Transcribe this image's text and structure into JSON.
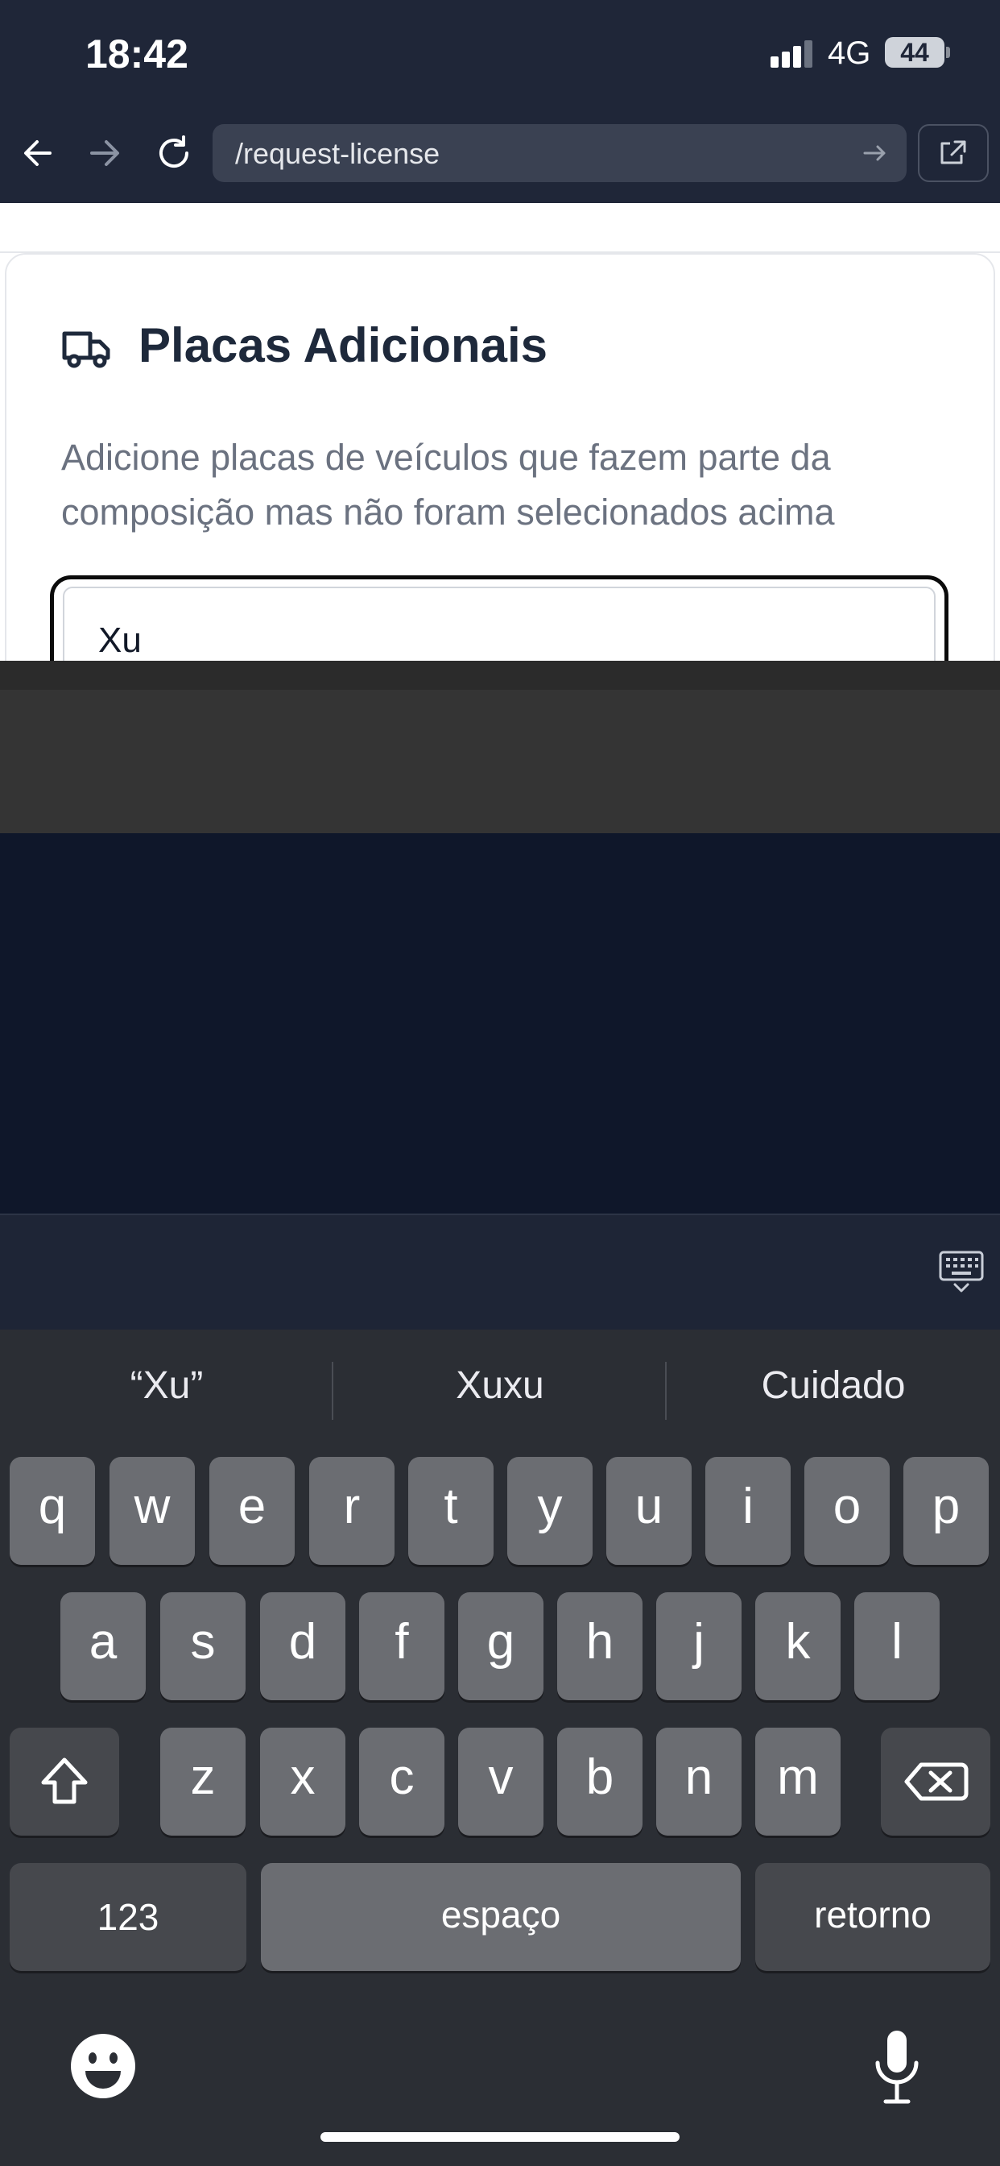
{
  "status_bar": {
    "time": "18:42",
    "network": "4G",
    "battery": "44"
  },
  "browser": {
    "url": "/request-license"
  },
  "card": {
    "title": "Placas Adicionais",
    "description": "Adicione placas de veículos que fazem parte da composição mas não foram selecionados acima",
    "plate_input_value": "Xu"
  },
  "keyboard": {
    "suggestions": [
      "“Xu”",
      "Xuxu",
      "Cuidado"
    ],
    "row1": [
      "q",
      "w",
      "e",
      "r",
      "t",
      "y",
      "u",
      "i",
      "o",
      "p"
    ],
    "row2": [
      "a",
      "s",
      "d",
      "f",
      "g",
      "h",
      "j",
      "k",
      "l"
    ],
    "row3": [
      "z",
      "x",
      "c",
      "v",
      "b",
      "n",
      "m"
    ],
    "numbers_label": "123",
    "space_label": "espaço",
    "return_label": "retorno"
  }
}
